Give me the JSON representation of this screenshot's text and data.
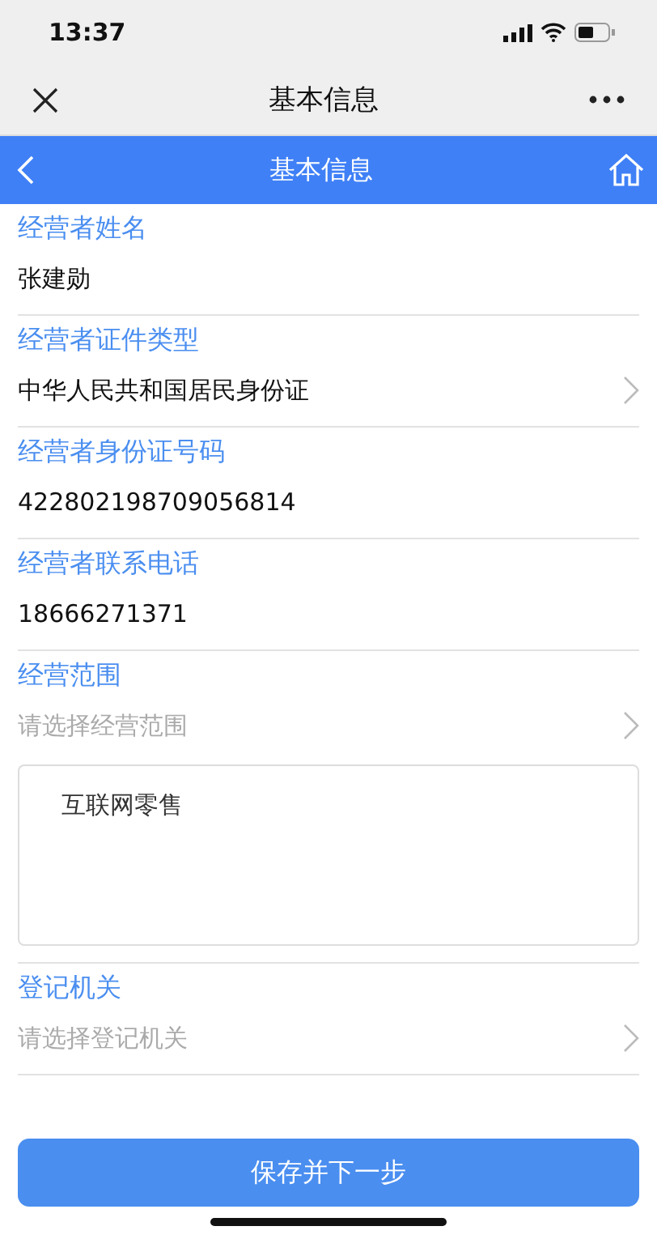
{
  "status_bar": {
    "time": "13:37"
  },
  "app_bar": {
    "title": "基本信息"
  },
  "header": {
    "title": "基本信息"
  },
  "fields": [
    {
      "kind": "text",
      "label": "经营者姓名",
      "value": "张建勋"
    },
    {
      "kind": "select",
      "label": "经营者证件类型",
      "value": "中华人民共和国居民身份证"
    },
    {
      "kind": "text",
      "label": "经营者身份证号码",
      "value": "422802198709056814"
    },
    {
      "kind": "text",
      "label": "经营者联系电话",
      "value": "18666271371"
    },
    {
      "kind": "select",
      "label": "经营范围",
      "placeholder": "请选择经营范围",
      "note": "互联网零售"
    },
    {
      "kind": "select",
      "label": "登记机关",
      "placeholder": "请选择登记机关"
    }
  ],
  "submit_button": "保存并下一步"
}
